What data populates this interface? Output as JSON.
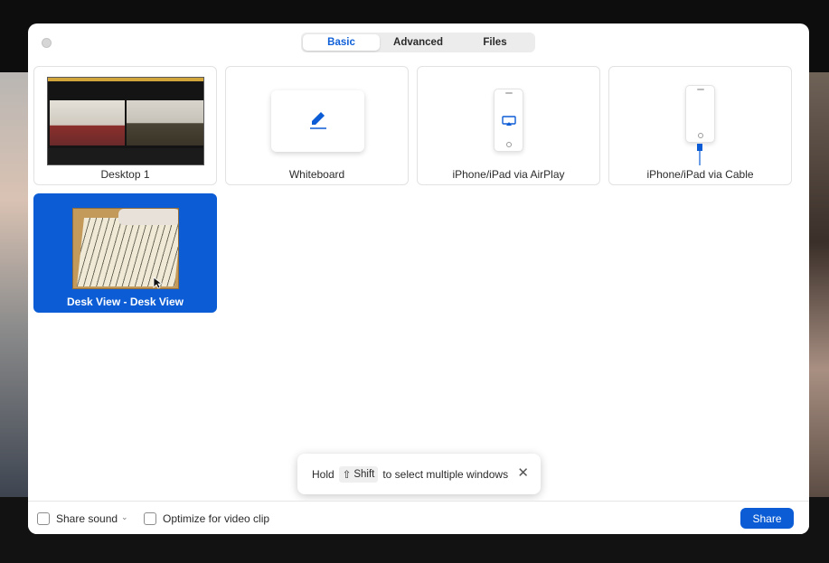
{
  "tabs": [
    {
      "label": "Basic",
      "active": true
    },
    {
      "label": "Advanced",
      "active": false
    },
    {
      "label": "Files",
      "active": false
    }
  ],
  "tiles": {
    "desktop": {
      "label": "Desktop 1"
    },
    "whiteboard": {
      "label": "Whiteboard",
      "icon": "pencil-icon"
    },
    "airplay": {
      "label": "iPhone/iPad via AirPlay",
      "icon": "airplay-icon"
    },
    "cable": {
      "label": "iPhone/iPad via Cable",
      "icon": "cable-icon"
    },
    "deskview": {
      "label": "Desk View - Desk View",
      "selected": true
    }
  },
  "toast": {
    "prefix": "Hold",
    "key_symbol": "⇧",
    "key_label": "Shift",
    "suffix": "to select multiple windows",
    "close_symbol": "✕"
  },
  "footer": {
    "share_sound_label": "Share sound",
    "share_sound_caret": "⌄",
    "optimize_label": "Optimize for video clip",
    "share_button": "Share"
  },
  "colors": {
    "accent": "#0b5cd5",
    "tab_active_text": "#0e5fd8"
  }
}
